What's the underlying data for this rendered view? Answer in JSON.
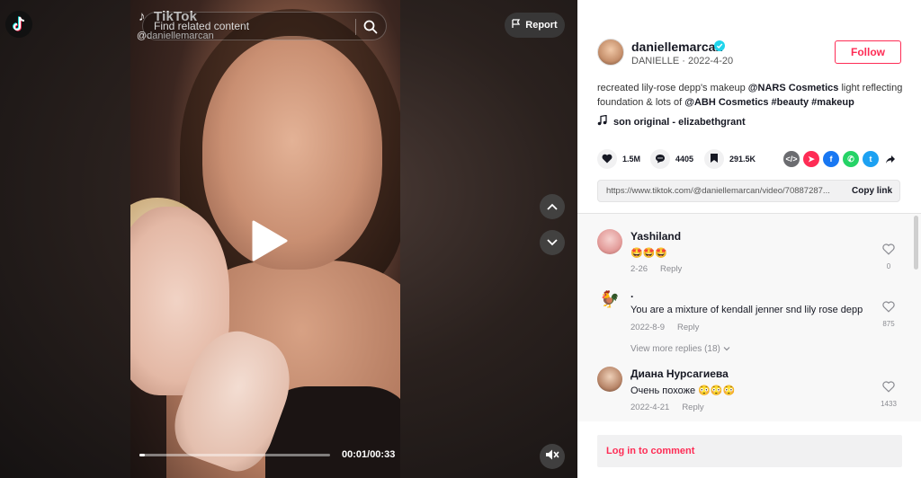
{
  "video": {
    "brand_label": "TikTok",
    "handle_overlay": "@daniellemarcan",
    "search_placeholder": "Find related content",
    "report_label": "Report",
    "time": "00:01/00:33",
    "progress_fraction": 0.03
  },
  "author": {
    "username": "daniellemarcan",
    "subline": "DANIELLE · 2022-4-20",
    "follow_label": "Follow"
  },
  "description": {
    "part1": "recreated lily-rose depp's makeup ",
    "mention1": "@NARS Cosmetics",
    "part2": " light reflecting foundation & lots of ",
    "mention2": "@ABH Cosmetics",
    "part3": " ",
    "tags": "#beauty #makeup"
  },
  "music": "son original - elizabethgrant",
  "stats": {
    "likes": "1.5M",
    "comments": "4405",
    "saves": "291.5K"
  },
  "share_icons": [
    "embed-icon",
    "send-icon",
    "facebook-icon",
    "whatsapp-icon",
    "twitter-icon",
    "share-arrow-icon"
  ],
  "link": {
    "url": "https://www.tiktok.com/@daniellemarcan/video/70887287...",
    "copy_label": "Copy link"
  },
  "comments": [
    {
      "user": "Yashiland",
      "text": "🤩🤩🤩",
      "date": "2-26",
      "reply": "Reply",
      "likes": "0"
    },
    {
      "user": ".",
      "text": "You are a mixture of kendall jenner snd lily rose depp",
      "date": "2022-8-9",
      "reply": "Reply",
      "likes": "875",
      "more_replies": "View more replies (18)"
    },
    {
      "user": "Диана Нурсагиева",
      "text": "Очень похоже 😳😳😳",
      "date": "2022-4-21",
      "reply": "Reply",
      "likes": "1433"
    }
  ],
  "login_label": "Log in to comment",
  "colors": {
    "accent": "#fe2c55",
    "verified": "#20d5ec"
  }
}
